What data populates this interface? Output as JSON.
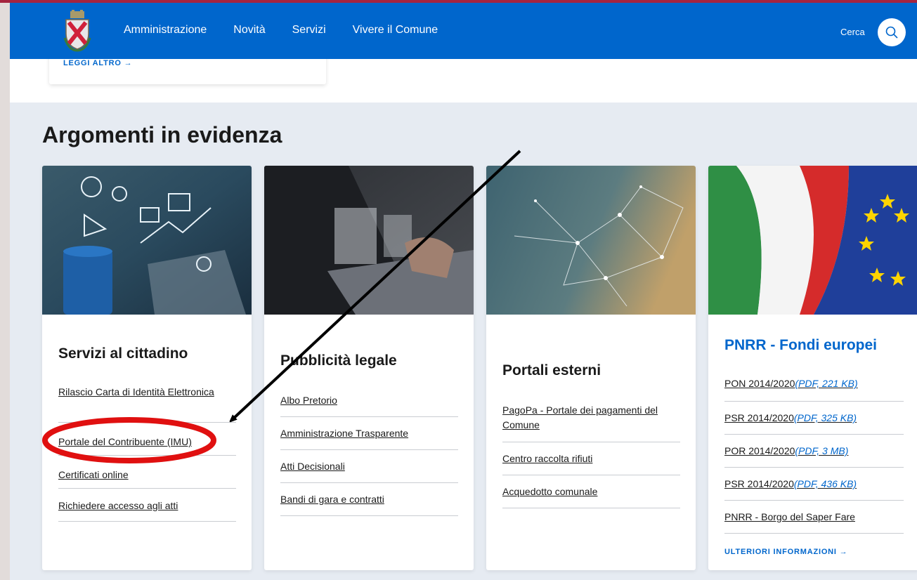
{
  "nav": {
    "items": [
      "Amministrazione",
      "Novità",
      "Servizi",
      "Vivere il Comune"
    ],
    "search_label": "Cerca"
  },
  "previous_card": {
    "read_more": "LEGGI ALTRO →"
  },
  "section_title": "Argomenti in evidenza",
  "cards": [
    {
      "title": "Servizi al cittadino",
      "links": [
        "Rilascio Carta di Identità Elettronica",
        "Portale del Contribuente (IMU)",
        "Certificati online",
        "Richiedere accesso agli atti"
      ]
    },
    {
      "title": "Pubblicità legale",
      "links": [
        "Albo Pretorio",
        "Amministrazione Trasparente",
        "Atti Decisionali",
        "Bandi di gara e contratti"
      ]
    },
    {
      "title": "Portali esterni",
      "links": [
        "PagoPa - Portale dei pagamenti del Comune",
        "Centro raccolta rifiuti",
        "Acquedotto comunale"
      ]
    },
    {
      "title": "PNRR - Fondi europei",
      "links": [
        {
          "text": "PON 2014/2020",
          "file": "(PDF, 221 KB)"
        },
        {
          "text": "PSR 2014/2020",
          "file": "(PDF, 325 KB)"
        },
        {
          "text": "POR 2014/2020",
          "file": "(PDF, 3 MB)"
        },
        {
          "text": "PSR 2014/2020",
          "file": "(PDF, 436 KB)"
        },
        {
          "text": "PNRR - Borgo del Saper Fare",
          "file": ""
        }
      ],
      "more": "ULTERIORI INFORMAZIONI →"
    }
  ],
  "colors": {
    "header_blue": "#0066cc",
    "annotation_red": "#e01010",
    "top_stripe": "#a5243f"
  }
}
